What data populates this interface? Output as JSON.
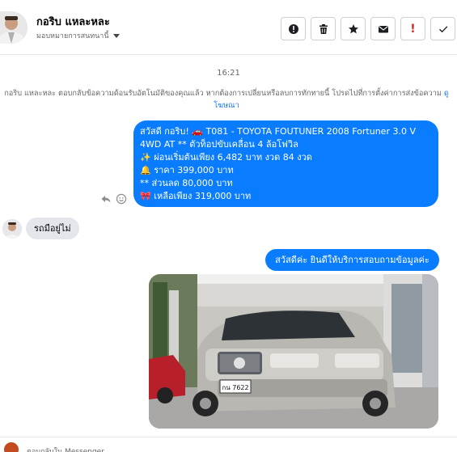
{
  "header": {
    "name": "กอริบ แหละหละ",
    "assign_label": "มอบหมายการสนทนานี้"
  },
  "actions": [
    {
      "name": "alert-circle-icon"
    },
    {
      "name": "trash-icon"
    },
    {
      "name": "star-icon"
    },
    {
      "name": "mail-icon"
    },
    {
      "name": "exclamation-icon",
      "glyph": "!"
    },
    {
      "name": "check-icon"
    }
  ],
  "thread": {
    "time": "16:21",
    "notice_text": "กอริบ แหละหละ ตอบกลับข้อความด้อนรับอัตโนมัติของคุณแล้ว หากต้องการเปลี่ยนหรือลบการทักทายนี้ โปรดไปที่การตั้งค่าการส่งข้อความ",
    "notice_link": "ดูโฆษณา",
    "message1": [
      "สวัสดี กอริบ! 🚗 T081 - TOYOTA FOUTUNER 2008 Fortuner 3.0 V",
      "4WD AT ** ตัวท็อปขับเคลื่อน 4 ล้อโฟวิล",
      "✨ ผ่อนเริ่มต้นเพียง 6,482 บาท งวด 84 งวด",
      "🔔 ราคา 399,000 บาท",
      "** ส่วนลด 80,000 บาท",
      "🎀 เหลือเพียง 319,000 บาท"
    ],
    "reply_in": "รถมือยู่ไม่",
    "message2": "สวัสดีค่ะ ยินดีให้บริการสอบถามข้อมูลค่ะ",
    "plate_text": "กน 7622"
  },
  "footer": {
    "text": "ตอบกลับใน Messenger"
  },
  "colors": {
    "accent": "#0a7cff",
    "link": "#1877f2",
    "incoming": "#e4e6eb"
  }
}
